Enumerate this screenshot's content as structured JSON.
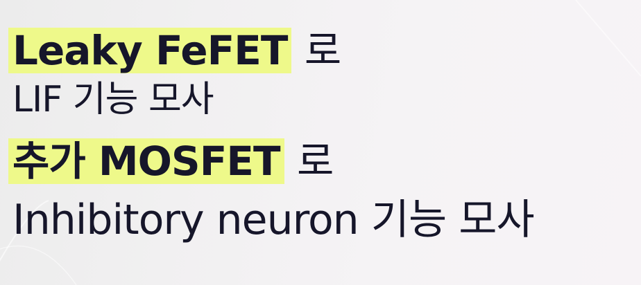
{
  "slide": {
    "line1": {
      "highlight": "Leaky FeFET",
      "suffix": "로"
    },
    "line2": {
      "text": "LIF 기능 모사"
    },
    "line3": {
      "highlight": "추가 MOSFET",
      "suffix": "로"
    },
    "line4": {
      "text": "Inhibitory neuron 기능 모사"
    }
  },
  "colors": {
    "highlight": "#eef98a",
    "text": "#16162a",
    "background": "#f3f1f3"
  }
}
